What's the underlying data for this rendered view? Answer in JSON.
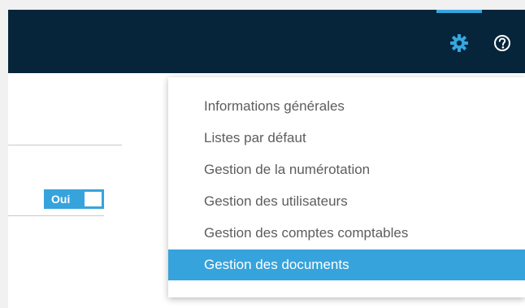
{
  "header": {
    "settings_icon": "gear-icon",
    "help_icon": "question-circle-icon",
    "accent_color": "#35a7e0",
    "background_color": "#06253a"
  },
  "toggle": {
    "label": "Oui",
    "state": true
  },
  "settings_menu": {
    "items": [
      {
        "label": "Informations générales",
        "active": false
      },
      {
        "label": "Listes par défaut",
        "active": false
      },
      {
        "label": "Gestion de la numérotation",
        "active": false
      },
      {
        "label": "Gestion des utilisateurs",
        "active": false
      },
      {
        "label": "Gestion des comptes comptables",
        "active": false
      },
      {
        "label": "Gestion des documents",
        "active": true
      }
    ]
  }
}
